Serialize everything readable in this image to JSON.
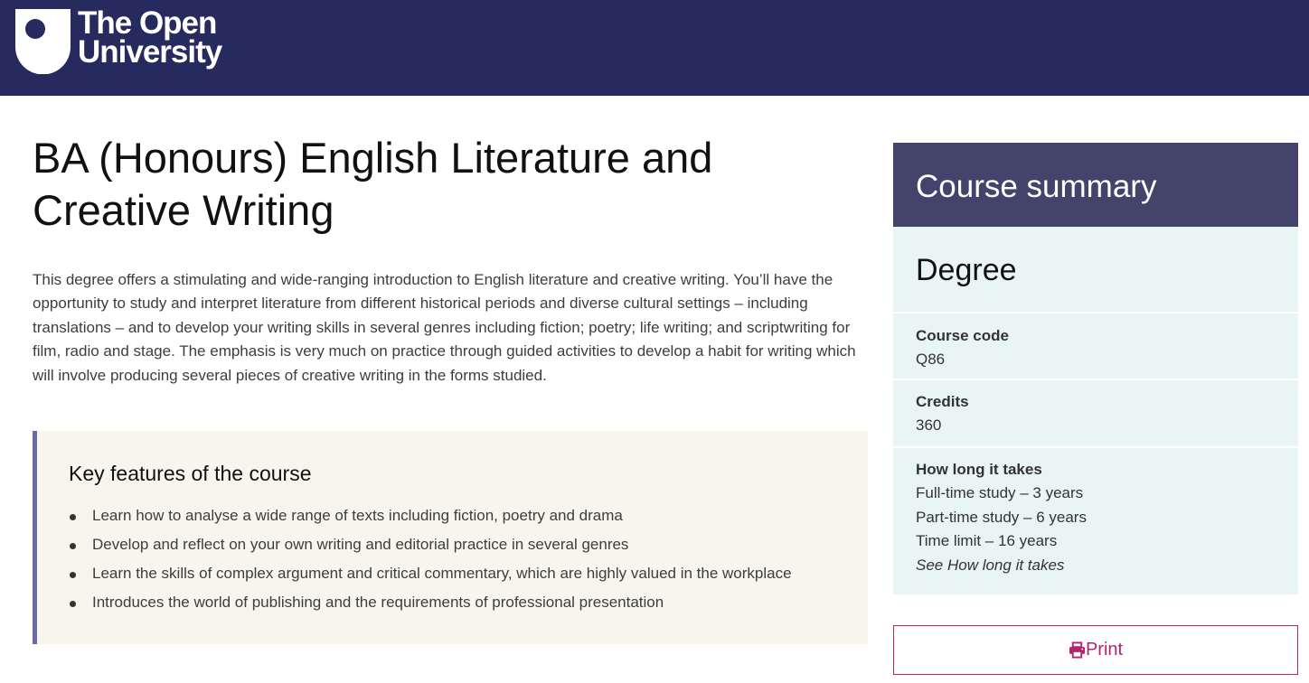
{
  "header": {
    "logo_line1": "The Open",
    "logo_line2": "University",
    "brand_color": "#262a5e"
  },
  "page": {
    "title": "BA (Honours) English Literature and Creative Writing",
    "intro": "This degree offers a stimulating and wide-ranging introduction to English literature and creative writing. You’ll have the opportunity to study and interpret literature from different historical periods and diverse cultural settings – including translations – and to develop your writing skills in several genres including fiction; poetry; life writing; and scriptwriting for film, radio and stage. The emphasis is very much on practice through guided activities to develop a habit for writing which will involve producing several pieces of creative writing in the forms studied."
  },
  "key_features": {
    "heading": "Key features of the course",
    "items": [
      "Learn how to analyse a wide range of texts including fiction, poetry and drama",
      "Develop and reflect on your own writing and editorial practice in several genres",
      "Learn the skills of complex argument and critical commentary, which are highly valued in the workplace",
      "Introduces the world of publishing and the requirements of professional presentation"
    ],
    "accent_color": "#6a6aa8"
  },
  "summary": {
    "heading": "Course summary",
    "qualification": "Degree",
    "course_code_label": "Course code",
    "course_code": "Q86",
    "credits_label": "Credits",
    "credits": "360",
    "duration_label": "How long it takes",
    "full_time": "Full-time study – 3 years",
    "part_time": "Part-time study – 6 years",
    "time_limit": "Time limit – 16 years",
    "see_link": "See How long it takes",
    "header_color": "#44436b",
    "panel_color": "#e9f4f5"
  },
  "actions": {
    "print_label": "Print",
    "print_icon": "printer-icon",
    "print_color": "#b3246f"
  }
}
